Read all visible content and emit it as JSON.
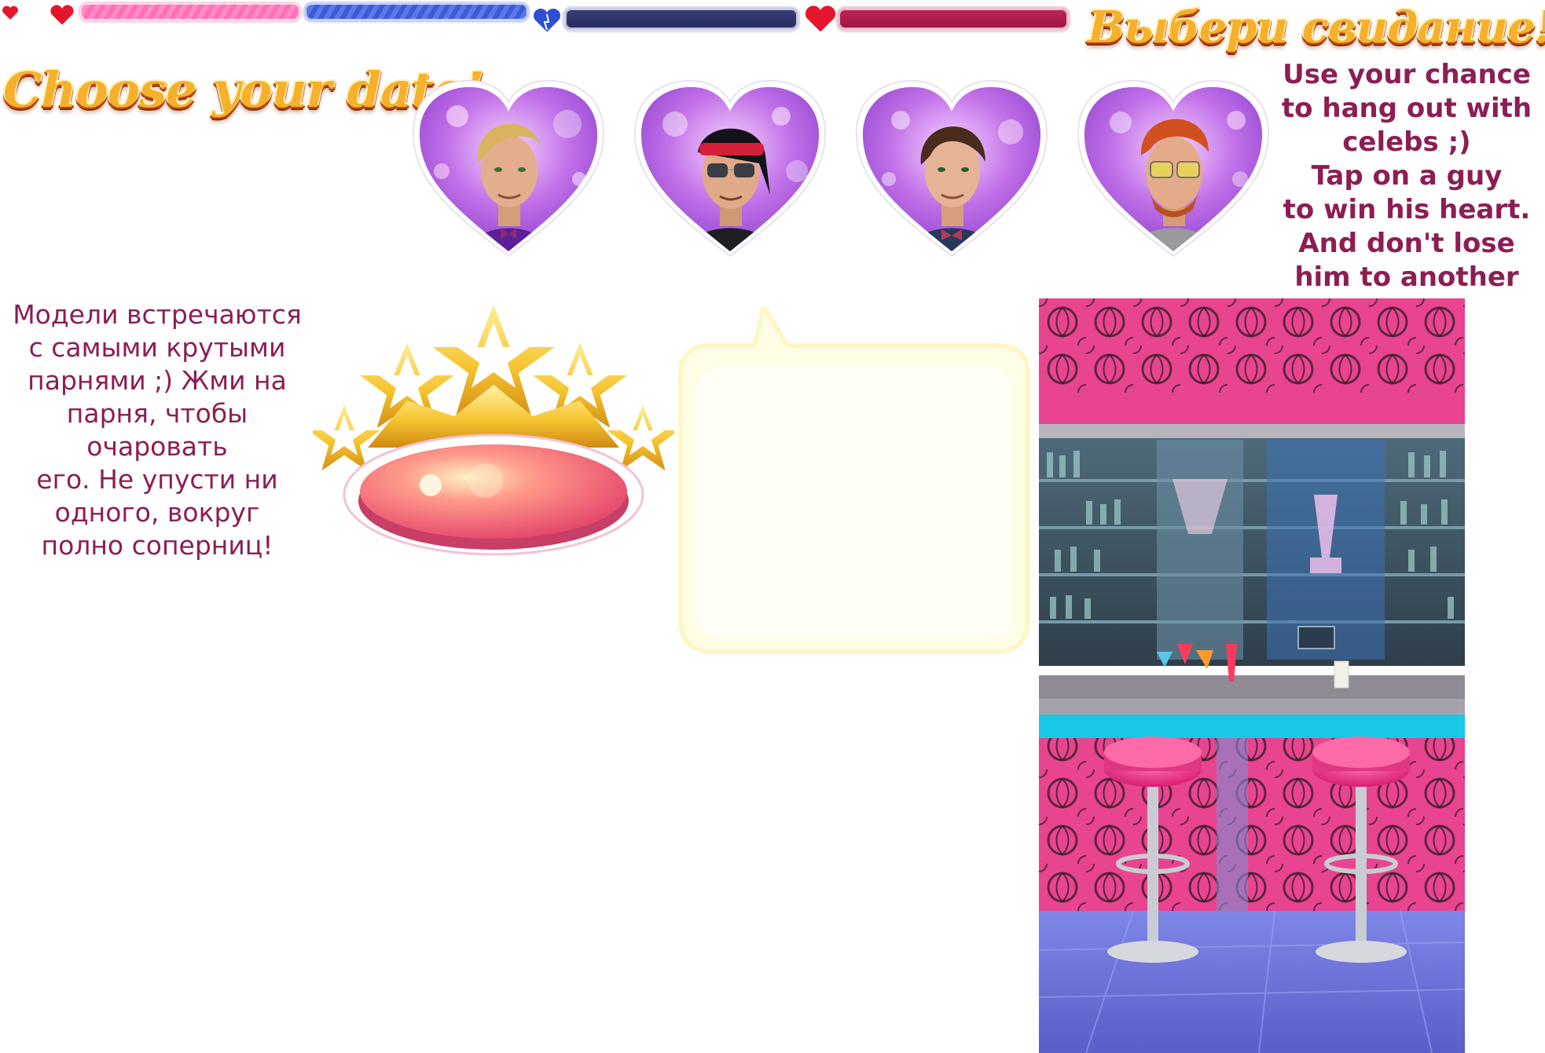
{
  "titles": {
    "english": "Choose your date!",
    "russian": "Выбери свидание!"
  },
  "instructions": {
    "english": "Use your chance\nto hang out with\ncelebs ;)\nTap on a guy\nto win his heart.\nAnd don't lose\nhim to another girl!",
    "russian": "Модели встречаются\nс самыми крутыми\nпарнями ;) Жми на\nпарня, чтобы очаровать\nего. Не упусти ни\nодного, вокруг\nполно соперниц!"
  },
  "date_candidates": [
    {
      "hair": "blonde",
      "outfit": "purple tuxedo with bow tie",
      "accessory": "none"
    },
    {
      "hair": "black",
      "outfit": "black leather jacket",
      "accessory": "red bandana and aviator sunglasses"
    },
    {
      "hair": "brown",
      "outfit": "navy blazer with bow tie",
      "accessory": "none"
    },
    {
      "hair": "red",
      "outfit": "grey t-shirt",
      "accessory": "yellow-tinted glasses"
    }
  ],
  "progress_bars": [
    {
      "color": "#ff7fbd",
      "style": "striped"
    },
    {
      "color": "#4a68e0",
      "style": "striped"
    },
    {
      "color": "#2f3370",
      "style": "solid",
      "icon": "blue-heart-icon"
    },
    {
      "color": "#b01c4e",
      "style": "solid",
      "icon": "red-heart-icon"
    }
  ],
  "colors": {
    "title_gold": "#f6b02b",
    "info_text": "#8c1e54",
    "scene_pink": "#e9448f",
    "scene_floor": "#6a73d6"
  },
  "assets": {
    "rating_badge": "five-star-crown-badge",
    "speech_bubble": "empty-speech-bubble",
    "background": "cocktail-bar-with-pink-stools"
  }
}
